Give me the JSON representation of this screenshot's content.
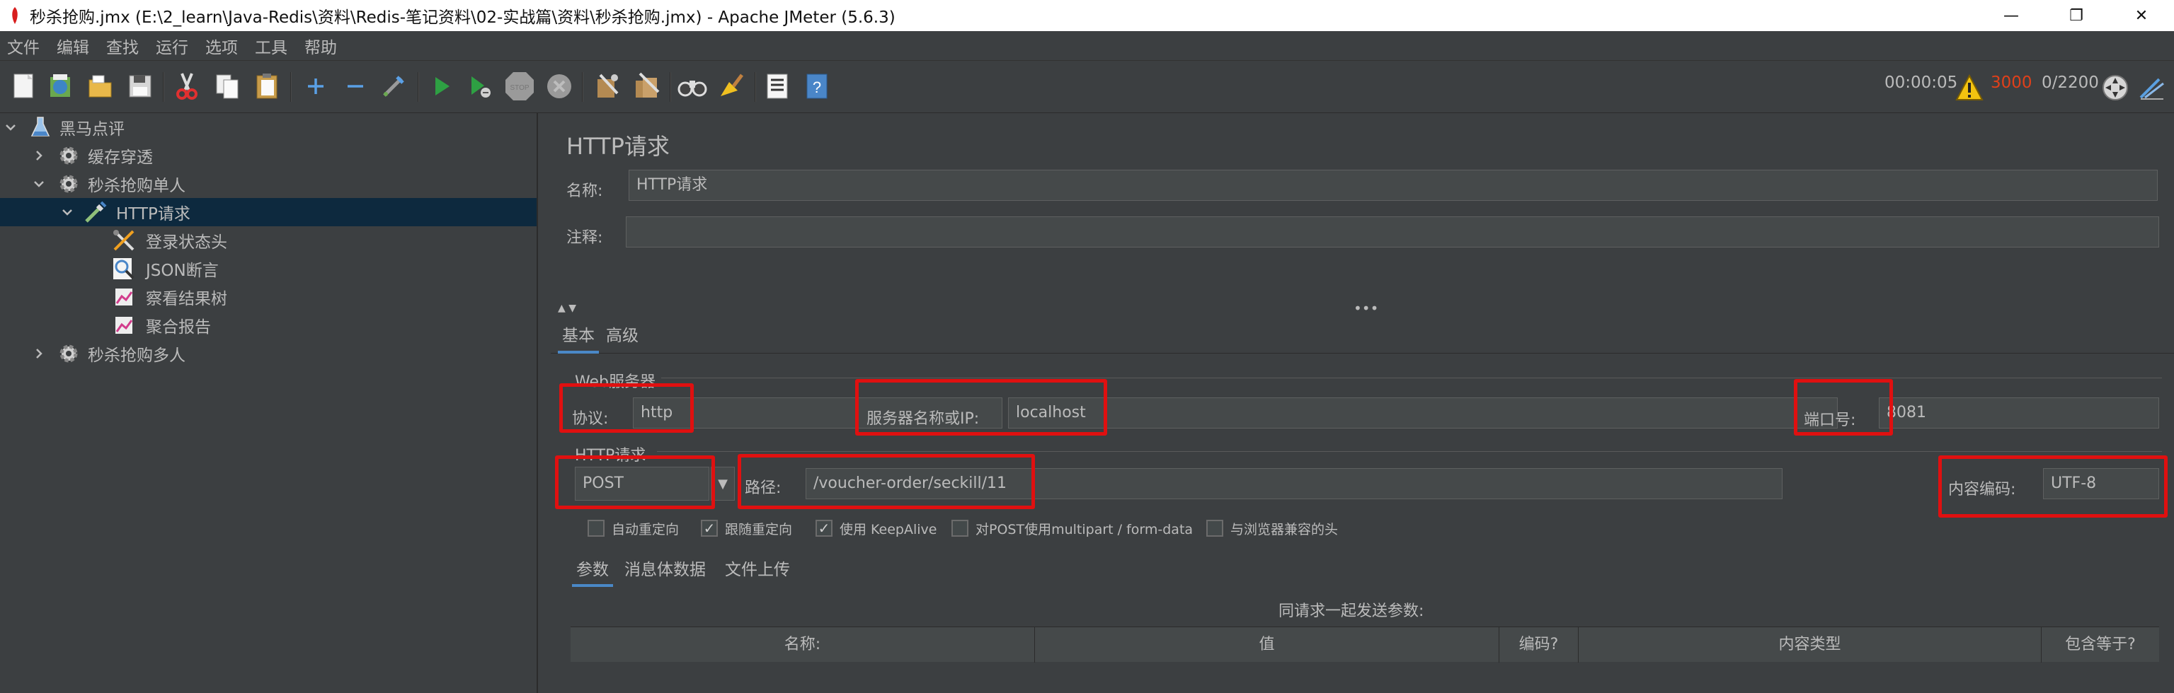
{
  "window": {
    "title": "秒杀抢购.jmx (E:\\2_learn\\Java-Redis\\资料\\Redis-笔记资料\\02-实战篇\\资料\\秒杀抢购.jmx) - Apache JMeter (5.6.3)",
    "minimize": "—",
    "maximize": "❐",
    "close": "✕"
  },
  "menu": [
    "文件",
    "编辑",
    "查找",
    "运行",
    "选项",
    "工具",
    "帮助"
  ],
  "toolbar": {
    "elapsed": "00:00:05",
    "error_count": "3000",
    "threads": "0/2200",
    "error_color": "#e0401a"
  },
  "tree": {
    "items": [
      {
        "label": "黑马点评",
        "icon": "flask-icon"
      },
      {
        "label": "缓存穿透",
        "icon": "gear-icon"
      },
      {
        "label": "秒杀抢购单人",
        "icon": "gear-icon"
      },
      {
        "label": "HTTP请求",
        "icon": "pipette-icon"
      },
      {
        "label": "登录状态头",
        "icon": "tools-icon"
      },
      {
        "label": "JSON断言",
        "icon": "magnifier-icon"
      },
      {
        "label": "察看结果树",
        "icon": "chart-icon"
      },
      {
        "label": "聚合报告",
        "icon": "chart-icon"
      },
      {
        "label": "秒杀抢购多人",
        "icon": "gear-icon"
      }
    ]
  },
  "panel": {
    "title": "HTTP请求",
    "name_label": "名称:",
    "name_value": "HTTP请求",
    "comment_label": "注释:",
    "comment_value": "",
    "tabs": [
      "基本",
      "高级"
    ],
    "web_server_group": "Web服务器",
    "protocol_label": "协议:",
    "protocol_value": "http",
    "server_label": "服务器名称或IP:",
    "server_value": "localhost",
    "port_label": "端口号:",
    "port_value": "8081",
    "http_request_group": "HTTP请求",
    "method_value": "POST",
    "path_label": "路径:",
    "path_value": "/voucher-order/seckill/11",
    "encoding_label": "内容编码:",
    "encoding_value": "UTF-8",
    "checkboxes": [
      {
        "label": "自动重定向",
        "checked": false
      },
      {
        "label": "跟随重定向",
        "checked": true
      },
      {
        "label": "使用 KeepAlive",
        "checked": true
      },
      {
        "label": "对POST使用multipart / form-data",
        "checked": false
      },
      {
        "label": "与浏览器兼容的头",
        "checked": false
      }
    ],
    "sub_tabs": [
      "参数",
      "消息体数据",
      "文件上传"
    ],
    "params_caption": "同请求一起发送参数:",
    "params_columns": [
      "名称:",
      "值",
      "编码?",
      "内容类型",
      "包含等于?"
    ]
  }
}
